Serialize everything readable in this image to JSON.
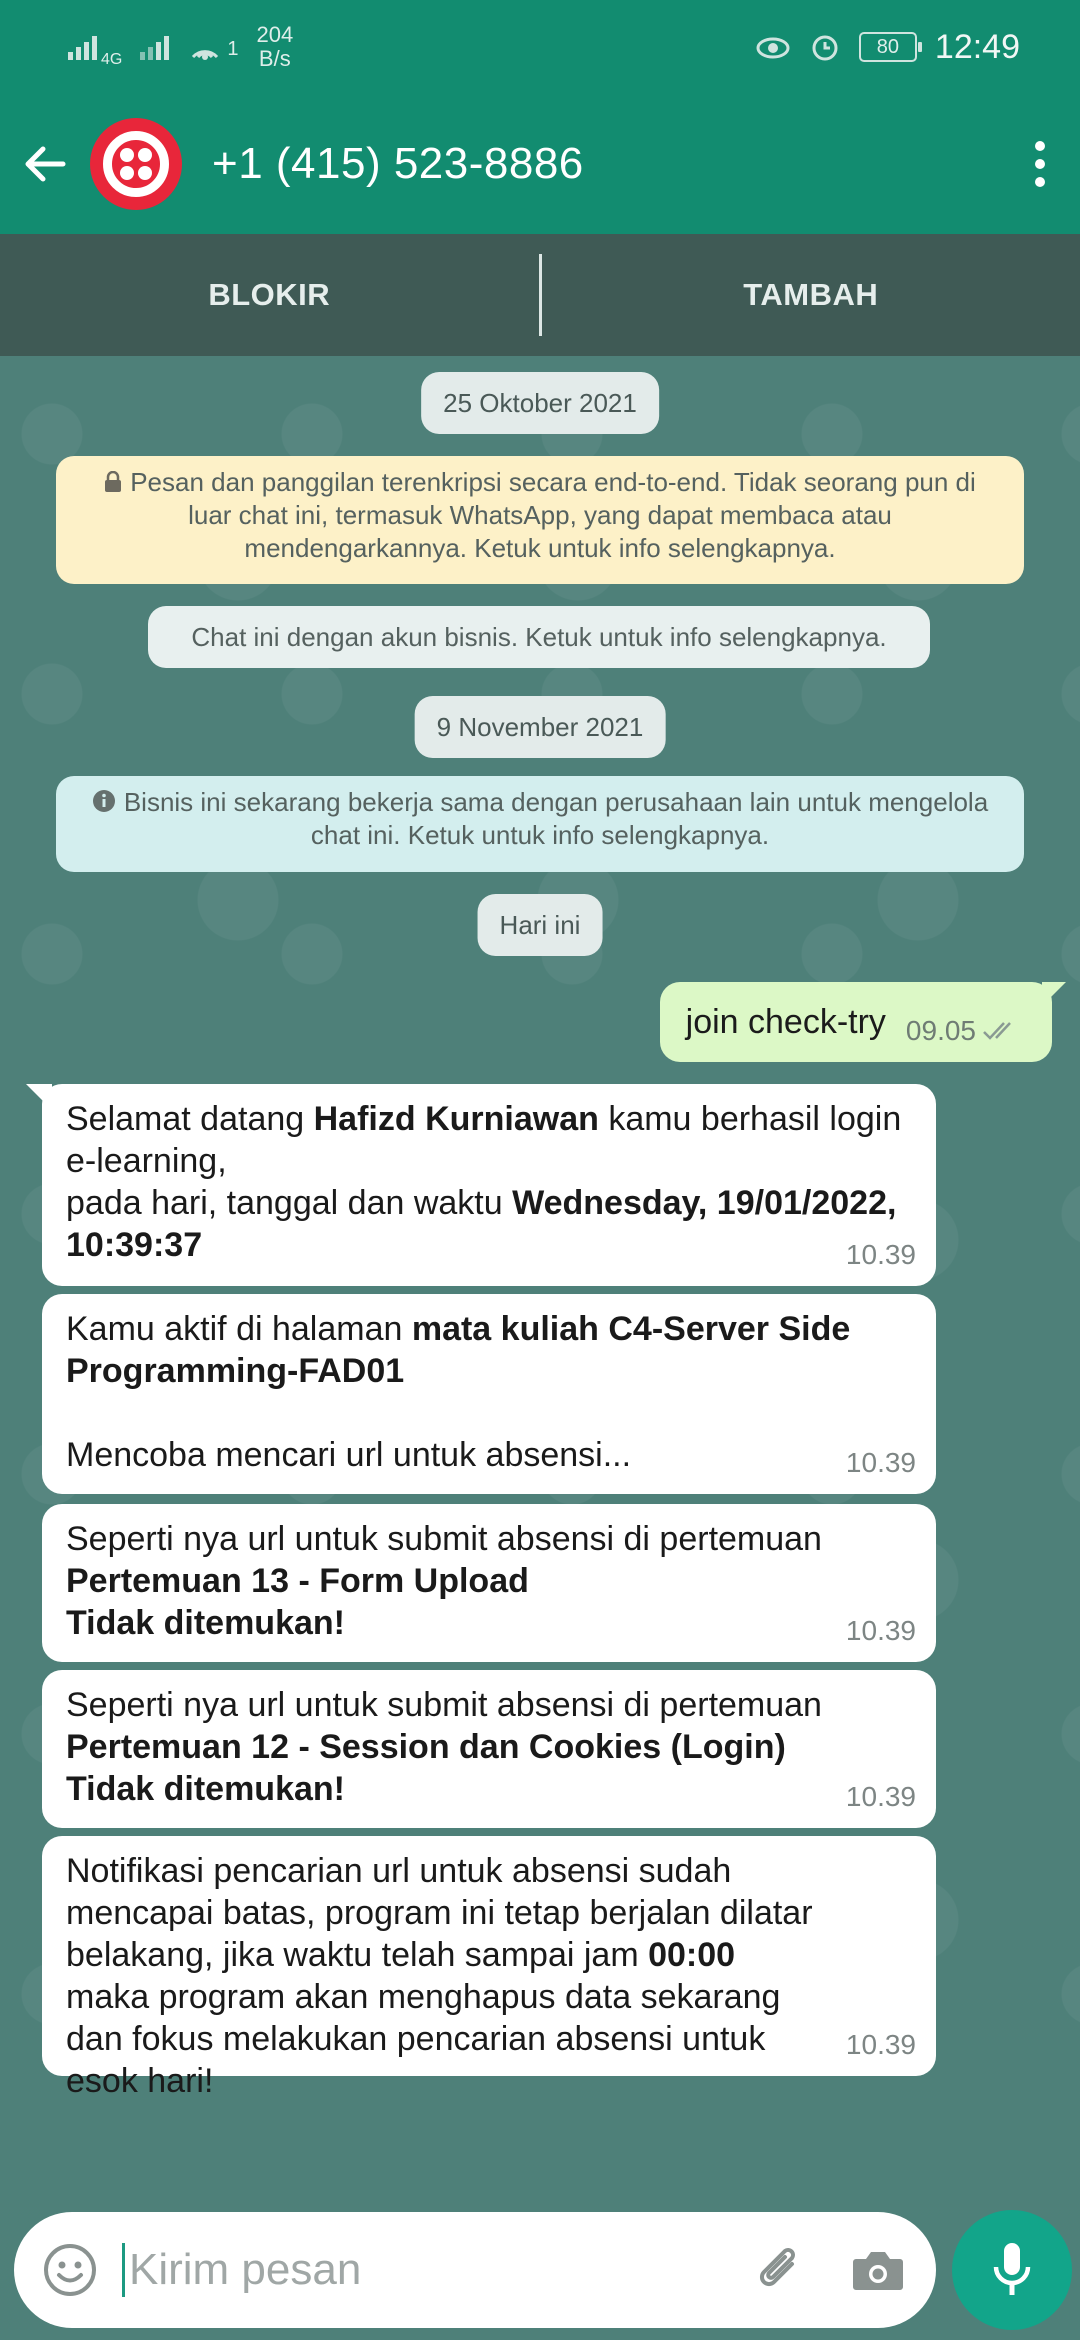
{
  "status_bar": {
    "network_type": "4G",
    "sim_indicator": "1",
    "speed_value": "204",
    "speed_unit": "B/s",
    "battery": "80",
    "time": "12:49"
  },
  "header": {
    "contact_name": "+1 (415) 523-8886",
    "icons": [
      "back-arrow-icon",
      "twilio-logo",
      "more-vert-icon"
    ]
  },
  "actions": {
    "block_label": "BLOKIR",
    "add_label": "TAMBAH"
  },
  "chat": {
    "date_1": "25 Oktober 2021",
    "encryption_notice": "Pesan dan panggilan terenkripsi secara end-to-end. Tidak seorang pun di luar chat ini, termasuk WhatsApp, yang dapat membaca atau mendengarkannya. Ketuk untuk info selengkapnya.",
    "business_notice": "Chat ini dengan akun bisnis. Ketuk untuk info selengkapnya.",
    "date_2": "9 November 2021",
    "partner_notice": "Bisnis ini sekarang bekerja sama dengan perusahaan lain untuk mengelola chat ini. Ketuk untuk info selengkapnya.",
    "date_3": "Hari ini",
    "outgoing": {
      "text": "join check-try",
      "time": "09.05"
    },
    "incoming": [
      {
        "p1": "Selamat datang ",
        "b1": "Hafizd Kurniawan",
        "p2": " kamu berhasil login e-learning,",
        "p3": "pada hari, tanggal dan waktu ",
        "b2": "Wednesday, 19/01/2022, 10:39:37",
        "time": "10.39"
      },
      {
        "p1": "Kamu aktif di halaman ",
        "b1": "mata kuliah C4-Server Side Programming-FAD01",
        "p2": "Mencoba mencari url untuk absensi...",
        "time": "10.39"
      },
      {
        "p1": "Seperti nya url untuk submit absensi di pertemuan",
        "b1": "Pertemuan 13 - Form Upload",
        "b2": "Tidak ditemukan!",
        "time": "10.39"
      },
      {
        "p1": "Seperti nya url untuk submit absensi di pertemuan",
        "b1": "Pertemuan 12 - Session dan Cookies (Login)",
        "b2": "Tidak ditemukan!",
        "time": "10.39"
      },
      {
        "p1": "Notifikasi pencarian url untuk absensi sudah mencapai batas, program ini tetap berjalan dilatar belakang, jika waktu telah sampai jam ",
        "b1": "00:00",
        "p2": " maka program akan menghapus data sekarang dan fokus melakukan pencarian absensi untuk esok hari!",
        "time": "10.39"
      }
    ]
  },
  "composer": {
    "placeholder": "Kirim pesan",
    "icons": [
      "emoji-icon",
      "attach-icon",
      "camera-icon",
      "mic-icon"
    ]
  },
  "colors": {
    "header": "#128c70",
    "chat_bg": "#4e8079",
    "outgoing_bubble": "#dcf8c6",
    "accent": "#12a58a"
  }
}
